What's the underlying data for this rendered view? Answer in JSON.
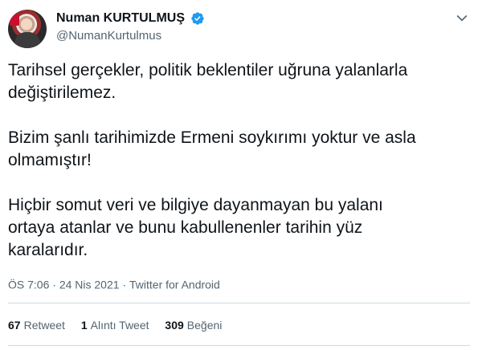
{
  "author": {
    "display_name": "Numan KURTULMUŞ",
    "handle": "@NumanKurtulmus",
    "verified": true,
    "verified_color": "#1d9bf0"
  },
  "tweet": {
    "text": "Tarihsel gerçekler, politik beklentiler uğruna yalanlarla\ndeğiştirilemez.\n\nBizim şanlı tarihimizde Ermeni soykırımı yoktur ve asla\nolmamıştır!\n\nHiçbir somut veri ve bilgiye dayanmayan bu yalanı\nortaya atanlar ve bunu kabullenenler tarihin yüz\nkaralarıdır."
  },
  "meta": {
    "time": "ÖS 7:06",
    "date": "24 Nis 2021",
    "source": "Twitter for Android",
    "separator": "·"
  },
  "stats": {
    "retweets_count": "67",
    "retweets_label": "Retweet",
    "quotes_count": "1",
    "quotes_label": "Alıntı Tweet",
    "likes_count": "309",
    "likes_label": "Beğeni"
  },
  "icons": {
    "avatar": "avatar-image",
    "verified": "verified-badge-icon",
    "more": "chevron-down-icon"
  }
}
